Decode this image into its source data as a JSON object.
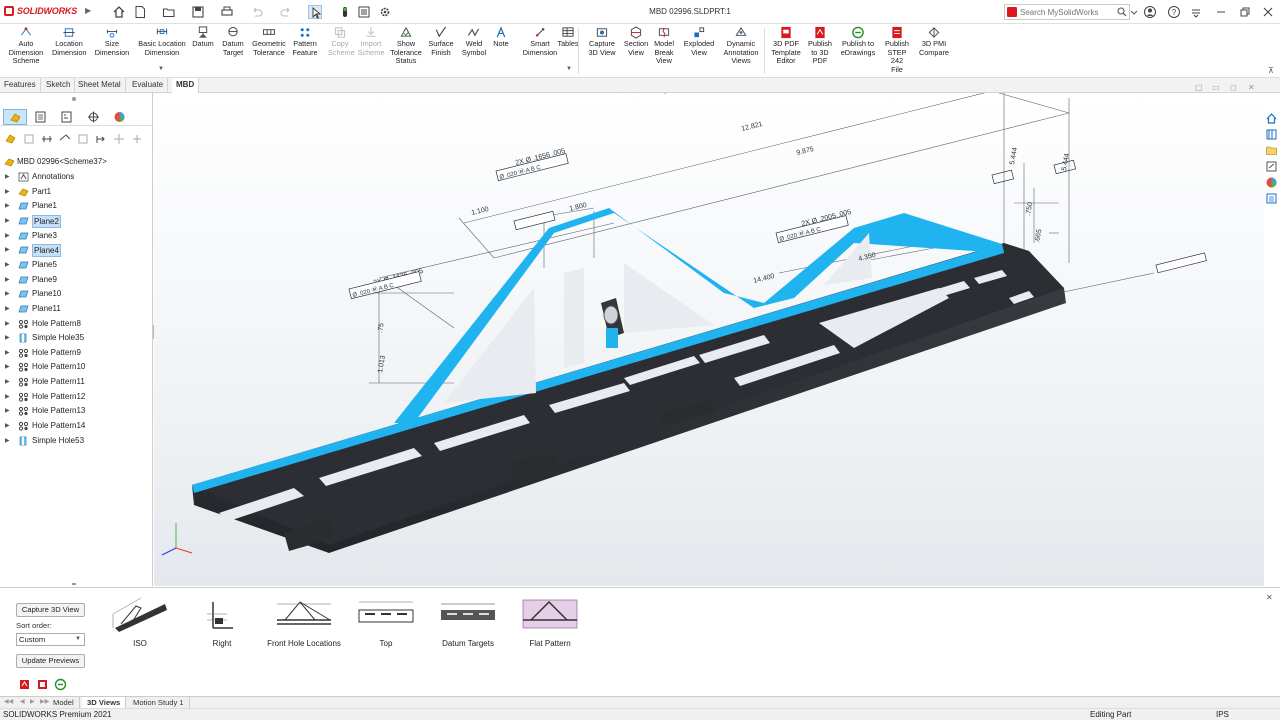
{
  "app": {
    "logo_text": "SOLIDWORKS",
    "document_title": "MBD 02996.SLDPRT:1",
    "accent": "#d71920"
  },
  "search": {
    "placeholder": "Search MySolidWorks"
  },
  "ribbon": {
    "buttons": [
      {
        "label": "Auto\nDimension\nScheme",
        "icon": "auto-dimension-icon",
        "enabled": true
      },
      {
        "label": "Location\nDimension",
        "icon": "location-dimension-icon",
        "enabled": true
      },
      {
        "label": "Size\nDimension",
        "icon": "size-dimension-icon",
        "enabled": true
      },
      {
        "label": "Basic Location\nDimension",
        "icon": "basic-location-dimension-icon",
        "enabled": true
      },
      {
        "label": "Datum",
        "icon": "datum-icon",
        "enabled": true
      },
      {
        "label": "Datum\nTarget",
        "icon": "datum-target-icon",
        "enabled": true
      },
      {
        "label": "Geometric\nTolerance",
        "icon": "geometric-tolerance-icon",
        "enabled": true
      },
      {
        "label": "Pattern\nFeature",
        "icon": "pattern-feature-icon",
        "enabled": true
      },
      {
        "label": "Copy\nScheme",
        "icon": "copy-scheme-icon",
        "enabled": false
      },
      {
        "label": "Import\nScheme",
        "icon": "import-scheme-icon",
        "enabled": false
      },
      {
        "label": "Show\nTolerance\nStatus",
        "icon": "show-tolerance-status-icon",
        "enabled": true
      },
      {
        "label": "Surface\nFinish",
        "icon": "surface-finish-icon",
        "enabled": true
      },
      {
        "label": "Weld\nSymbol",
        "icon": "weld-symbol-icon",
        "enabled": true
      },
      {
        "label": "Note",
        "icon": "note-icon",
        "enabled": true
      },
      {
        "label": "Smart\nDimension",
        "icon": "smart-dimension-icon",
        "enabled": true
      },
      {
        "label": "Tables",
        "icon": "tables-icon",
        "enabled": true
      },
      {
        "label": "Capture\n3D View",
        "icon": "capture-3d-view-icon",
        "enabled": true
      },
      {
        "label": "Section\nView",
        "icon": "section-view-icon",
        "enabled": true
      },
      {
        "label": "Model\nBreak\nView",
        "icon": "model-break-view-icon",
        "enabled": true
      },
      {
        "label": "Exploded\nView",
        "icon": "exploded-view-icon",
        "enabled": true
      },
      {
        "label": "Dynamic\nAnnotation\nViews",
        "icon": "dynamic-annotation-views-icon",
        "enabled": true
      },
      {
        "label": "3D PDF\nTemplate\nEditor",
        "icon": "3d-pdf-template-editor-icon",
        "enabled": true
      },
      {
        "label": "Publish\nto 3D\nPDF",
        "icon": "publish-3d-pdf-icon",
        "enabled": true
      },
      {
        "label": "Publish to\neDrawings",
        "icon": "publish-edrawings-icon",
        "enabled": true
      },
      {
        "label": "Publish\nSTEP 242\nFile",
        "icon": "publish-step-242-icon",
        "enabled": true
      },
      {
        "label": "3D PMI\nCompare",
        "icon": "3d-pmi-compare-icon",
        "enabled": true
      }
    ]
  },
  "command_tabs": [
    "Features",
    "Sketch",
    "Sheet Metal",
    "Evaluate",
    "MBD"
  ],
  "tree": {
    "root": "MBD 02996<Scheme37>",
    "items": [
      {
        "label": "Annotations",
        "icon": "annotations-icon",
        "selected": false
      },
      {
        "label": "Part1",
        "icon": "part-icon",
        "selected": false
      },
      {
        "label": "Plane1",
        "icon": "plane-icon",
        "selected": false
      },
      {
        "label": "Plane2",
        "icon": "plane-icon",
        "selected": true
      },
      {
        "label": "Plane3",
        "icon": "plane-icon",
        "selected": false
      },
      {
        "label": "Plane4",
        "icon": "plane-icon",
        "selected": true
      },
      {
        "label": "Plane5",
        "icon": "plane-icon",
        "selected": false
      },
      {
        "label": "Plane9",
        "icon": "plane-icon",
        "selected": false
      },
      {
        "label": "Plane10",
        "icon": "plane-icon",
        "selected": false
      },
      {
        "label": "Plane11",
        "icon": "plane-icon",
        "selected": false
      },
      {
        "label": "Hole Pattern8",
        "icon": "hole-pattern-icon",
        "selected": false
      },
      {
        "label": "Simple Hole35",
        "icon": "simple-hole-icon",
        "selected": false
      },
      {
        "label": "Hole Pattern9",
        "icon": "hole-pattern-icon",
        "selected": false
      },
      {
        "label": "Hole Pattern10",
        "icon": "hole-pattern-icon",
        "selected": false
      },
      {
        "label": "Hole Pattern11",
        "icon": "hole-pattern-icon",
        "selected": false
      },
      {
        "label": "Hole Pattern12",
        "icon": "hole-pattern-icon",
        "selected": false
      },
      {
        "label": "Hole Pattern13",
        "icon": "hole-pattern-icon",
        "selected": false
      },
      {
        "label": "Hole Pattern14",
        "icon": "hole-pattern-icon",
        "selected": false
      },
      {
        "label": "Simple Hole53",
        "icon": "simple-hole-icon",
        "selected": false
      }
    ]
  },
  "model": {
    "highlight_color": "#1fb4f0",
    "plate_color": "#2f3135",
    "dimensions": [
      "12.821",
      "9.875",
      "1.100",
      "1.800",
      "2X Ø .1635 .005",
      "2X Ø .1656 .005",
      "2X Ø .2005 .005",
      "Ø .020 Ⓜ A B C",
      "5.444",
      "5.444",
      "3.444",
      ".750",
      ".665",
      ".75",
      "1.013",
      "14.400",
      "4.350"
    ]
  },
  "views_pane": {
    "capture_label": "Capture 3D View",
    "sort_label": "Sort order:",
    "sort_value": "Custom",
    "update_label": "Update Previews",
    "views": [
      "ISO",
      "Right",
      "Front Hole Locations",
      "Top",
      "Datum Targets",
      "Flat Pattern"
    ]
  },
  "doc_tabs": [
    "Model",
    "3D Views",
    "Motion Study 1"
  ],
  "active_doc_tab": "3D Views",
  "status": {
    "app_version": "SOLIDWORKS Premium 2021",
    "mode": "Editing Part",
    "units": "IPS"
  }
}
